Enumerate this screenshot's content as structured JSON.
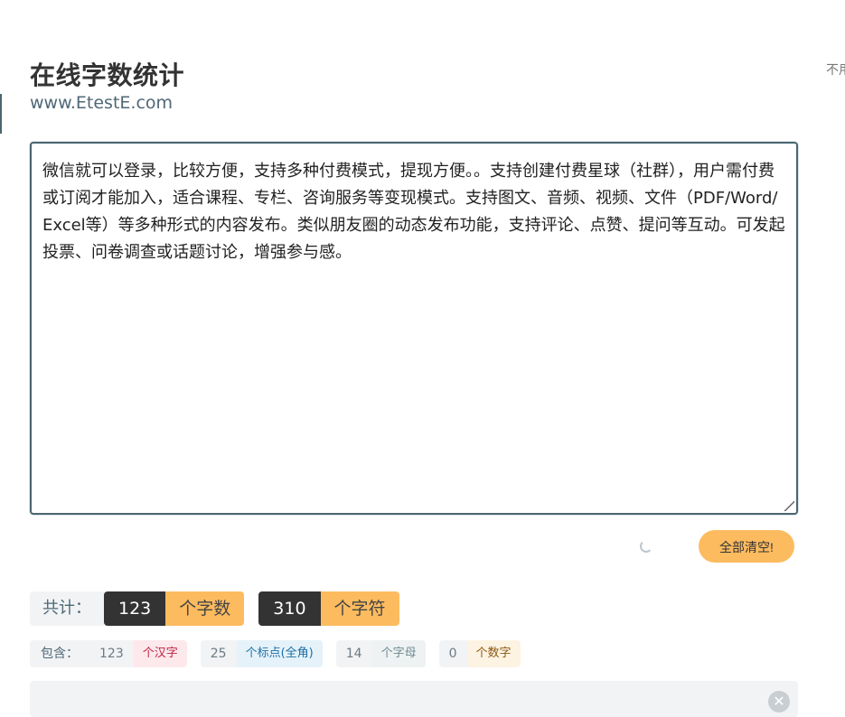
{
  "header": {
    "title": "在线字数统计",
    "subtitle": "www.EtestE.com",
    "cut_off_text": "不用"
  },
  "editor": {
    "content": "微信就可以登录，比较方便，支持多种付费模式，提现方便。。支持创建付费星球（社群），用户需付费或订阅才能加入，适合课程、专栏、咨询服务等变现模式。支持图文、音频、视频、文件（PDF/Word/Excel等）等多种形式的内容发布。类似朋友圈的动态发布功能，支持评论、点赞、提问等互动。可发起投票、问卷调查或话题讨论，增强参与感。"
  },
  "actions": {
    "clear_label": "全部清空!"
  },
  "totals": {
    "label": "共计：",
    "word_count": "123",
    "word_unit": "个字数",
    "char_count": "310",
    "char_unit": "个字符"
  },
  "details": {
    "label": "包含：",
    "items": [
      {
        "count": "123",
        "unit": "个汉字",
        "color": "#c02340"
      },
      {
        "count": "25",
        "unit": "个标点(全角)",
        "color": "#1d6fa5"
      },
      {
        "count": "14",
        "unit": "个字母",
        "color": "#6d8a93"
      },
      {
        "count": "0",
        "unit": "个数字",
        "color": "#8a5a12"
      }
    ]
  },
  "colors": {
    "accent_dark": "#333333",
    "accent_orange": "#fdbb5f",
    "border": "#4a6670"
  },
  "icons": {
    "spinner": "loading-spinner-icon",
    "close": "close-icon",
    "resize": "resize-handle-icon"
  }
}
